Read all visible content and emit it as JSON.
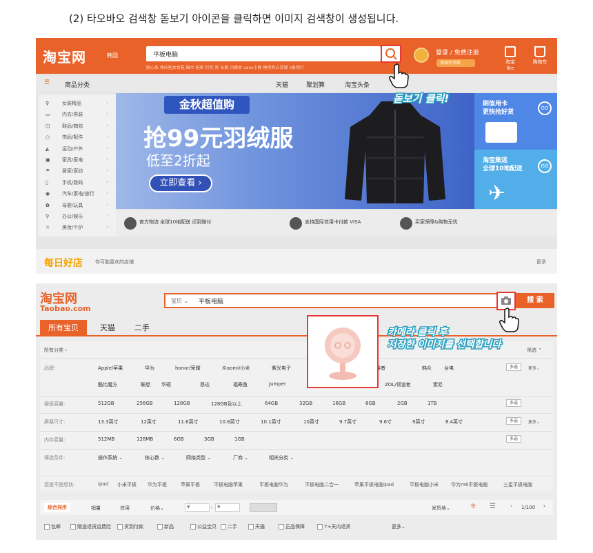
{
  "instruction": "(2) 타오바오 검색창 돋보기 아이콘을 클릭하면 이미지 검색창이 생성됩니다.",
  "top_screen": {
    "logo": "淘宝网",
    "logo_region": "韩国",
    "search_query": "平板电脑",
    "search_tooltip": "搜索",
    "hot_words": "耐心系 休闲拖女女鞋 围巾 鞋柜 打包 男 长靴 内裤女 vans小鹿 睡袍男五货铺 3备用灯",
    "login": "登录 / 免费注册",
    "coupon": "领海外币纸",
    "qr_label": "淘宝lite",
    "cart_label": "购物车",
    "nav_category": "商品分类",
    "nav_links": [
      "天猫",
      "聚划算",
      "淘宝头条"
    ],
    "sidebar": [
      {
        "icon": "dress-icon",
        "label": "女装精品"
      },
      {
        "icon": "shirt-icon",
        "label": "内衣/男装"
      },
      {
        "icon": "bag-icon",
        "label": "鞋品/箱包"
      },
      {
        "icon": "ring-icon",
        "label": "饰品/配件"
      },
      {
        "icon": "shoe-icon",
        "label": "运动/户外"
      },
      {
        "icon": "tv-icon",
        "label": "家具/家电"
      },
      {
        "icon": "umbrella-icon",
        "label": "居家/家纺"
      },
      {
        "icon": "phone-icon",
        "label": "手机/数码"
      },
      {
        "icon": "car-icon",
        "label": "汽车/家电/旅行"
      },
      {
        "icon": "toy-icon",
        "label": "母婴/玩具"
      },
      {
        "icon": "search-icon",
        "label": "办公/娱乐"
      },
      {
        "icon": "bulb-icon",
        "label": "美妆/个护"
      }
    ],
    "banner": {
      "tag": "金秋超值购",
      "headline": "抢99元羽绒服",
      "sub": "低至2折起",
      "cta": "立即查看 ›"
    },
    "promo1": {
      "title": "刷信用卡\n更快抢好货",
      "go": "GO"
    },
    "promo2": {
      "title": "淘宝集运\n全球10地配送",
      "go": "GO"
    },
    "features": [
      "官方物流 全球10地配送 迟到赔付",
      "支持国际信用卡付款 VISA",
      "买家保障&购物无忧"
    ],
    "goodshop": "每日好店",
    "goodshop_sub": "你可能喜欢的店铺",
    "more": "更多",
    "annotation": "돋보기 클릭!"
  },
  "bottom_screen": {
    "logo": "淘宝网",
    "logo_sub": "Taobao.com",
    "search_scope": "宝贝 ⌄",
    "search_query": "平板电脑",
    "search_button": "搜 索",
    "tabs": [
      "所有宝贝",
      "天猫",
      "二手"
    ],
    "all_category": "所有分类 ›",
    "brand_label": "品牌:",
    "brands_row1": [
      "Apple/苹果",
      "华为",
      "honor/荣耀",
      "Xiaomi/小米",
      "紫光电子",
      "酷睿者",
      "韩众",
      "台电"
    ],
    "brands_row2": [
      "酷比魔方",
      "联想",
      "华硕",
      "昂达",
      "福寿鱼",
      "Jumper",
      "HMX/华米星",
      "HP",
      "ZOL/领道者",
      "索尼"
    ],
    "storage_label": "硬盘容量:",
    "storage": [
      "512GB",
      "256GB",
      "128GB",
      "128GB及以上",
      "64GB",
      "32GB",
      "16GB",
      "8GB",
      "2GB",
      "1TB"
    ],
    "screen_label": "屏幕尺寸:",
    "screen": [
      "13.3英寸",
      "12英寸",
      "11.6英寸",
      "10.8英寸",
      "10.1英寸",
      "10英寸",
      "9.7英寸",
      "9.6寸",
      "9英寸",
      "8.4英寸"
    ],
    "ram_label": "内存容量:",
    "ram": [
      "512MB",
      "128MB",
      "6GB",
      "3GB",
      "1GB"
    ],
    "cond_label": "筛选条件:",
    "conditions": [
      "操作系统 ⌄",
      "核心数 ⌄",
      "网络类型 ⌄",
      "厂商 ⌄",
      "相关分类 ⌄"
    ],
    "multi": "多选",
    "more_label": "更多⌄",
    "filter_label": "筛选 ⌃",
    "guess_label": "您是不是想找:",
    "guesses": [
      "ipad",
      "小米平板",
      "华为平板",
      "苹果平板",
      "平板电脑苹果",
      "平板电脑华为",
      "平板电脑二合一",
      "苹果平板电脑ipad",
      "平板电脑小米",
      "华为m6平板电脑",
      "三星平板电脑"
    ],
    "sort": [
      "综合排序",
      "销量",
      "信用",
      "价格⌄"
    ],
    "price_from": "¥",
    "price_to": "¥",
    "ship_from": "发货地⌄",
    "page": "1/100",
    "checks": [
      "包邮",
      "赠送退货运费险",
      "货到付款",
      "新品",
      "公益宝贝",
      "二手",
      "天猫",
      "正品保障",
      "7+天内退货"
    ],
    "checks_more": "更多⌄",
    "annotation": "카메라 클릭 후\n저장한 이미지를 선택합니다"
  },
  "colors": {
    "taobao_orange": "#e9622a",
    "highlight_red": "#e53935",
    "annotation_outline": "#2a9fbf"
  }
}
